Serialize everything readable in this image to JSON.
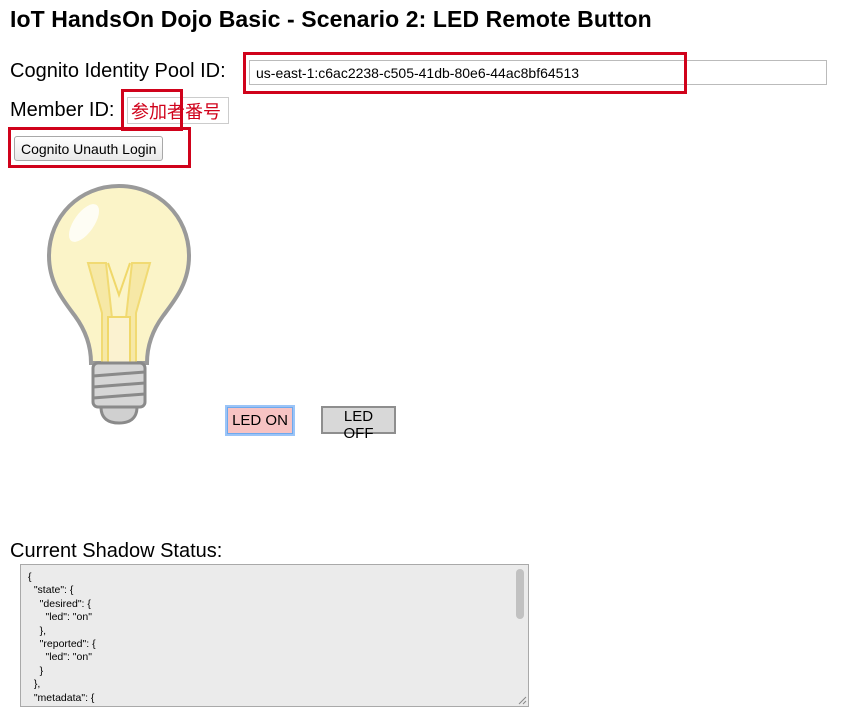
{
  "page": {
    "title": "IoT HandsOn Dojo Basic - Scenario 2: LED Remote Button"
  },
  "form": {
    "pool_label": "Cognito Identity Pool ID:",
    "pool_value": "us-east-1:c6ac2238-c505-41db-80e6-44ac8bf64513",
    "member_label": "Member ID:",
    "member_value": "参加者番号",
    "login_label": "Cognito Unauth Login"
  },
  "led": {
    "on_label": "LED ON",
    "off_label": "LED OFF",
    "state": "on"
  },
  "shadow": {
    "label": "Current Shadow Status:",
    "text": "{\n  \"state\": {\n    \"desired\": {\n      \"led\": \"on\"\n    },\n    \"reported\": {\n      \"led\": \"on\"\n    }\n  },\n  \"metadata\": {\n    \"desired\": {"
  },
  "colors": {
    "annotation_red": "#d0021b",
    "led_on_bg": "#f7c3c3",
    "bulb_glass": "#fbf4c8"
  },
  "icons": {
    "bulb": "light-bulb-icon",
    "scroll": "scrollbar-thumb",
    "resize": "resize-grip-icon"
  }
}
